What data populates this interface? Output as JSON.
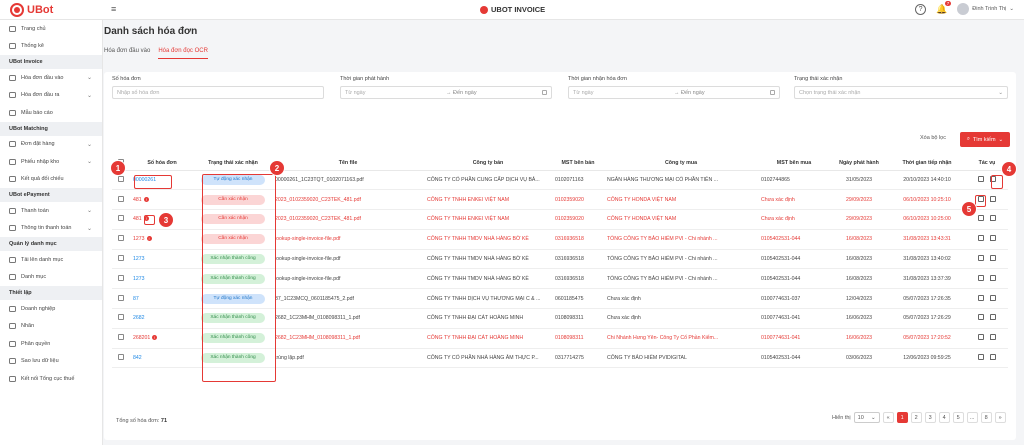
{
  "brand": {
    "logo": "UBot",
    "center": "UBOT INVOICE"
  },
  "header": {
    "help_icon": "?",
    "notif_count": "7",
    "user_name": "Đinh Trinh Thị"
  },
  "sidebar": {
    "items": [
      {
        "type": "item",
        "label": "Trang chủ",
        "icon": "home-icon"
      },
      {
        "type": "item",
        "label": "Thống kê",
        "icon": "chart-icon"
      },
      {
        "type": "section",
        "label": "UBot Invoice"
      },
      {
        "type": "item",
        "label": "Hóa đơn đầu vào",
        "icon": "inbox-icon",
        "chevron": true
      },
      {
        "type": "item",
        "label": "Hóa đơn đầu ra",
        "icon": "outbox-icon",
        "chevron": true
      },
      {
        "type": "item",
        "label": "Mẫu báo cáo",
        "icon": "report-icon"
      },
      {
        "type": "section",
        "label": "UBot Matching"
      },
      {
        "type": "item",
        "label": "Đơn đặt hàng",
        "icon": "cart-icon",
        "chevron": true
      },
      {
        "type": "item",
        "label": "Phiếu nhập kho",
        "icon": "box-icon",
        "chevron": true
      },
      {
        "type": "item",
        "label": "Kết quả đối chiếu",
        "icon": "check-icon"
      },
      {
        "type": "section",
        "label": "UBot ePayment"
      },
      {
        "type": "item",
        "label": "Thanh toán",
        "icon": "card-icon",
        "chevron": true
      },
      {
        "type": "item",
        "label": "Thông tin thanh toán",
        "icon": "info-icon",
        "chevron": true
      },
      {
        "type": "section",
        "label": "Quản lý danh mục"
      },
      {
        "type": "item",
        "label": "Tải lên danh mục",
        "icon": "upload-icon"
      },
      {
        "type": "item",
        "label": "Danh mục",
        "icon": "list-icon"
      },
      {
        "type": "section",
        "label": "Thiết lập"
      },
      {
        "type": "item",
        "label": "Doanh nghiệp",
        "icon": "building-icon"
      },
      {
        "type": "item",
        "label": "Nhãn",
        "icon": "tag-icon"
      },
      {
        "type": "item",
        "label": "Phân quyền",
        "icon": "users-icon"
      },
      {
        "type": "item",
        "label": "Sao lưu dữ liệu",
        "icon": "backup-icon"
      },
      {
        "type": "item",
        "label": "Kết nối Tổng cục thuế",
        "icon": "link-icon"
      }
    ]
  },
  "page": {
    "title": "Danh sách hóa đơn",
    "tabs": [
      "Hóa đơn đầu vào",
      "Hóa đơn đọc OCR"
    ],
    "active_tab": 1
  },
  "filters": {
    "invoice_no": {
      "label": "Số hóa đơn",
      "placeholder": "Nhập số hóa đơn"
    },
    "issue_time": {
      "label": "Thời gian phát hành",
      "from": "Từ ngày",
      "to": "Đến ngày"
    },
    "receive_time": {
      "label": "Thời gian nhận hóa đơn",
      "from": "Từ ngày",
      "to": "Đến ngày"
    },
    "status": {
      "label": "Trạng thái xác nhận",
      "placeholder": "Chọn trạng thái xác nhận"
    },
    "clear": "Xóa bộ lọc",
    "search": "Tìm kiếm"
  },
  "table": {
    "headers": [
      "Số hóa đơn",
      "Trạng thái xác nhận",
      "Tên file",
      "Công ty bán",
      "MST bên bán",
      "Công ty mua",
      "MST bên mua",
      "Ngày phát hành",
      "Thời gian tiếp nhận",
      "Tác vụ"
    ],
    "rows": [
      {
        "no": "00000261",
        "warn": false,
        "status": "Tự động xác nhận",
        "stype": "blue",
        "file": "00000261_1C23TQT_0102071163.pdf",
        "seller": "CÔNG TY CỔ PHẦN CUNG CẤP DỊCH VỤ BẢ...",
        "seller_tax": "0102071163",
        "buyer": "NGÂN HÀNG THƯƠNG MẠI CỔ PHẦN TIÊN ...",
        "buyer_tax": "0102744865",
        "date": "31/05/2023",
        "received": "20/10/2023 14:40:10",
        "red": false
      },
      {
        "no": "481",
        "warn": true,
        "status": "Cần xác nhận",
        "stype": "red",
        "file": "2023_0102359020_C23TEK_481.pdf",
        "seller": "CÔNG TY TNHH ENKEI VIỆT NAM",
        "seller_tax": "0102359020",
        "buyer": "CÔNG TY HONDA VIỆT NAM",
        "buyer_tax": "Chưa xác định",
        "date": "29/09/2023",
        "received": "06/10/2023 10:25:10",
        "red": true
      },
      {
        "no": "481",
        "warn": true,
        "status": "Cần xác nhận",
        "stype": "red",
        "file": "2023_0102359020_C23TEK_481.pdf",
        "seller": "CÔNG TY TNHH ENKEI VIỆT NAM",
        "seller_tax": "0102359020",
        "buyer": "CÔNG TY HONDA VIỆT NAM",
        "buyer_tax": "Chưa xác định",
        "date": "29/09/2023",
        "received": "06/10/2023 10:25:00",
        "red": true
      },
      {
        "no": "1273",
        "warn": true,
        "status": "Cần xác nhận",
        "stype": "red",
        "file": "lookup-single-invoice-file.pdf",
        "seller": "CÔNG TY TNHH TMDV NHÀ HÀNG BỜ KÈ",
        "seller_tax": "0316936518",
        "buyer": "TỔNG CÔNG TY BẢO HIỂM PVI - Chi nhánh ...",
        "buyer_tax": "0105402531-044",
        "date": "16/08/2023",
        "received": "31/08/2023 13:43:31",
        "red": true
      },
      {
        "no": "1273",
        "warn": false,
        "status": "Xác nhận thành công",
        "stype": "green",
        "file": "lookup-single-invoice-file.pdf",
        "seller": "CÔNG TY TNHH TMDV NHÀ HÀNG BỜ KÈ",
        "seller_tax": "0316936518",
        "buyer": "TỔNG CÔNG TY BẢO HIỂM PVI - Chi nhánh ...",
        "buyer_tax": "0105402531-044",
        "date": "16/08/2023",
        "received": "31/08/2023 13:40:02",
        "red": false
      },
      {
        "no": "1273",
        "warn": false,
        "status": "Xác nhận thành công",
        "stype": "green",
        "file": "lookup-single-invoice-file.pdf",
        "seller": "CÔNG TY TNHH TMDV NHÀ HÀNG BỜ KÈ",
        "seller_tax": "0316936518",
        "buyer": "TỔNG CÔNG TY BẢO HIỂM PVI - Chi nhánh ...",
        "buyer_tax": "0105402531-044",
        "date": "16/08/2023",
        "received": "31/08/2023 13:37:39",
        "red": false
      },
      {
        "no": "87",
        "warn": false,
        "status": "Tự động xác nhận",
        "stype": "blue",
        "file": "87_1C23MCQ_0601185475_2.pdf",
        "seller": "CÔNG TY TNHH DỊCH VỤ THƯƠNG MẠI C & ...",
        "seller_tax": "0601185475",
        "buyer": "Chưa xác định",
        "buyer_tax": "0100774631-037",
        "date": "12/04/2023",
        "received": "05/07/2023 17:26:35",
        "red": false
      },
      {
        "no": "2682",
        "warn": false,
        "status": "Xác nhận thành công",
        "stype": "green",
        "file": "2682_1C23MHM_0108098311_1.pdf",
        "seller": "CÔNG TY TNHH ĐẠI CÁT HOÀNG MINH",
        "seller_tax": "0108098311",
        "buyer": "Chưa xác định",
        "buyer_tax": "0100774631-041",
        "date": "16/06/2023",
        "received": "05/07/2023 17:26:29",
        "red": false
      },
      {
        "no": "268201",
        "warn": true,
        "status": "Xác nhận thành công",
        "stype": "green",
        "file": "2682_1C23MHM_0108098311_1.pdf",
        "seller": "CÔNG TY TNHH ĐẠI CÁT HOÀNG MINH",
        "seller_tax": "0108098311",
        "buyer": "Chi Nhánh Hưng Yên- Công Ty Cổ Phần Kiểm...",
        "buyer_tax": "0100774631-041",
        "date": "16/06/2023",
        "received": "05/07/2023 17:20:52",
        "red": true
      },
      {
        "no": "842",
        "warn": false,
        "status": "Xác nhận thành công",
        "stype": "green",
        "file": "trùng lặp.pdf",
        "seller": "CÔNG TY CỔ PHẦN NHÀ HÀNG ÂM THỰC P...",
        "seller_tax": "0317714275",
        "buyer": "CÔNG TY BẢO HIỂM PVIDIGITAL",
        "buyer_tax": "0105402531-044",
        "date": "03/06/2023",
        "received": "12/06/2023 09:59:25",
        "red": false
      }
    ]
  },
  "footer": {
    "total_label": "Tổng số hóa đơn:",
    "total": "71",
    "per_page_label": "Hiển thị",
    "per_page": "10",
    "pages": [
      "1",
      "2",
      "3",
      "4",
      "5",
      "...",
      "8"
    ],
    "prev": "«",
    "next": "»"
  },
  "markers": [
    "1",
    "2",
    "3",
    "4",
    "5"
  ],
  "colors": {
    "accent": "#e53935",
    "blue_badge": "#1a73c7",
    "green_badge": "#2e8b47"
  }
}
